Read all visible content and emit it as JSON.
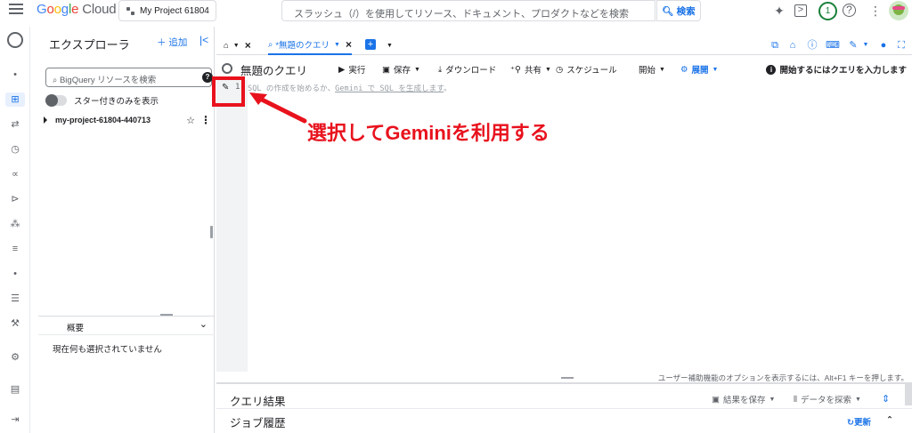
{
  "topbar": {
    "logo": [
      "G",
      "o",
      "o",
      "g",
      "l",
      "e"
    ],
    "logo_cloud": "Cloud",
    "project": "My Project 61804",
    "search_placeholder": "スラッシュ（/）を使用してリソース、ドキュメント、プロダクトなどを検索",
    "search_button": "検索",
    "notification_count": "1"
  },
  "explorer": {
    "title": "エクスプローラ",
    "add": "追加",
    "search_placeholder": "BigQuery リソースを検索",
    "help": "?",
    "starred_only": "スター付きのみを表示",
    "project_id": "my-project-61804-440713",
    "detail_title": "概要",
    "nothing_selected": "現在何も選択されていません"
  },
  "tabs": {
    "query_tab": "*無題のクエリ"
  },
  "query": {
    "title": "無題のクエリ",
    "run": "実行",
    "save": "保存",
    "download": "ダウンロード",
    "share": "共有",
    "schedule": "スケジュール",
    "start": "開始",
    "deploy": "展開",
    "hint": "開始するにはクエリを入力します",
    "line_number": "1",
    "placeholder_prefix": "SQL の作成を始めるか、",
    "placeholder_gemini": "Gemini で SQL を生成します",
    "placeholder_suffix": "。"
  },
  "annotation": "選択してGeminiを利用する",
  "accessibility_hint": "ユーザー補助機能のオプションを表示するには、Alt+F1 キーを押します。",
  "results": {
    "title": "クエリ結果",
    "save_results": "結果を保存",
    "explore_data": "データを探索"
  },
  "history": {
    "title": "ジョブ履歴",
    "refresh": "更新"
  },
  "colors": {
    "accent": "#1a73e8",
    "annotation_red": "#e8121d"
  }
}
